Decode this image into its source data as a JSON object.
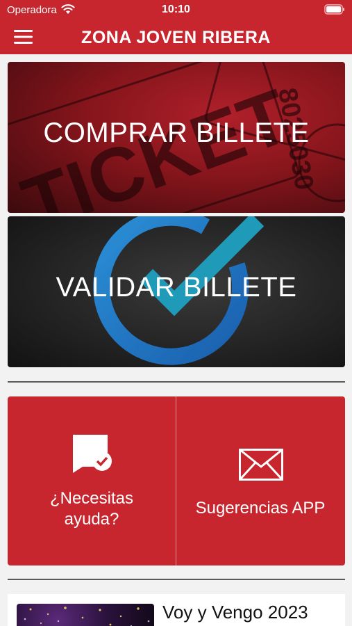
{
  "status_bar": {
    "carrier": "Operadora",
    "time": "10:10"
  },
  "header": {
    "title": "ZONA JOVEN RIBERA"
  },
  "cards": {
    "buy": {
      "label": "COMPRAR BILLETE"
    },
    "validate": {
      "label": "VALIDAR BILLETE"
    }
  },
  "tiles": {
    "help": {
      "label_line1": "¿Necesitas",
      "label_line2": "ayuda?"
    },
    "suggestions": {
      "label": "Sugerencias APP"
    }
  },
  "news": {
    "title": "Voy y Vengo 2023"
  },
  "colors": {
    "brand_red": "#c8262e",
    "background": "#f2f2f2",
    "divider": "#5a5a5a"
  },
  "icons": {
    "menu": "menu-icon",
    "wifi": "wifi-icon",
    "battery": "battery-icon",
    "help": "chat-check-icon",
    "suggestions": "mail-icon"
  }
}
